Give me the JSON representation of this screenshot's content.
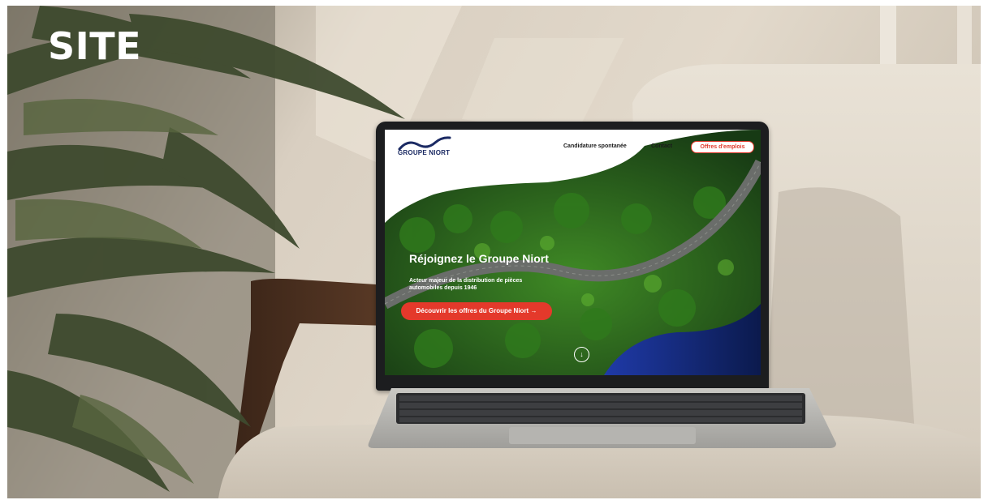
{
  "heading": {
    "text": "SITE"
  },
  "website": {
    "logo": {
      "text": "GROUPE NIORT",
      "icon": "wave-logo-icon"
    },
    "nav": {
      "items": [
        {
          "label": "Candidature spontanée"
        },
        {
          "label": "Contact"
        }
      ],
      "cta_label": "Offres d'emplois"
    },
    "hero": {
      "title": "Réjoignez le Groupe Niort",
      "subtitle": "Acteur majeur de la distribution de pièces automobiles depuis 1946",
      "button_label": "Découvrir les offres du Groupe Niort →",
      "scroll_icon": "chevron-down-circle-icon"
    },
    "colors": {
      "brand_blue": "#1b2a63",
      "accent_red": "#e4392b",
      "forest_green": "#2f6b1f"
    }
  }
}
